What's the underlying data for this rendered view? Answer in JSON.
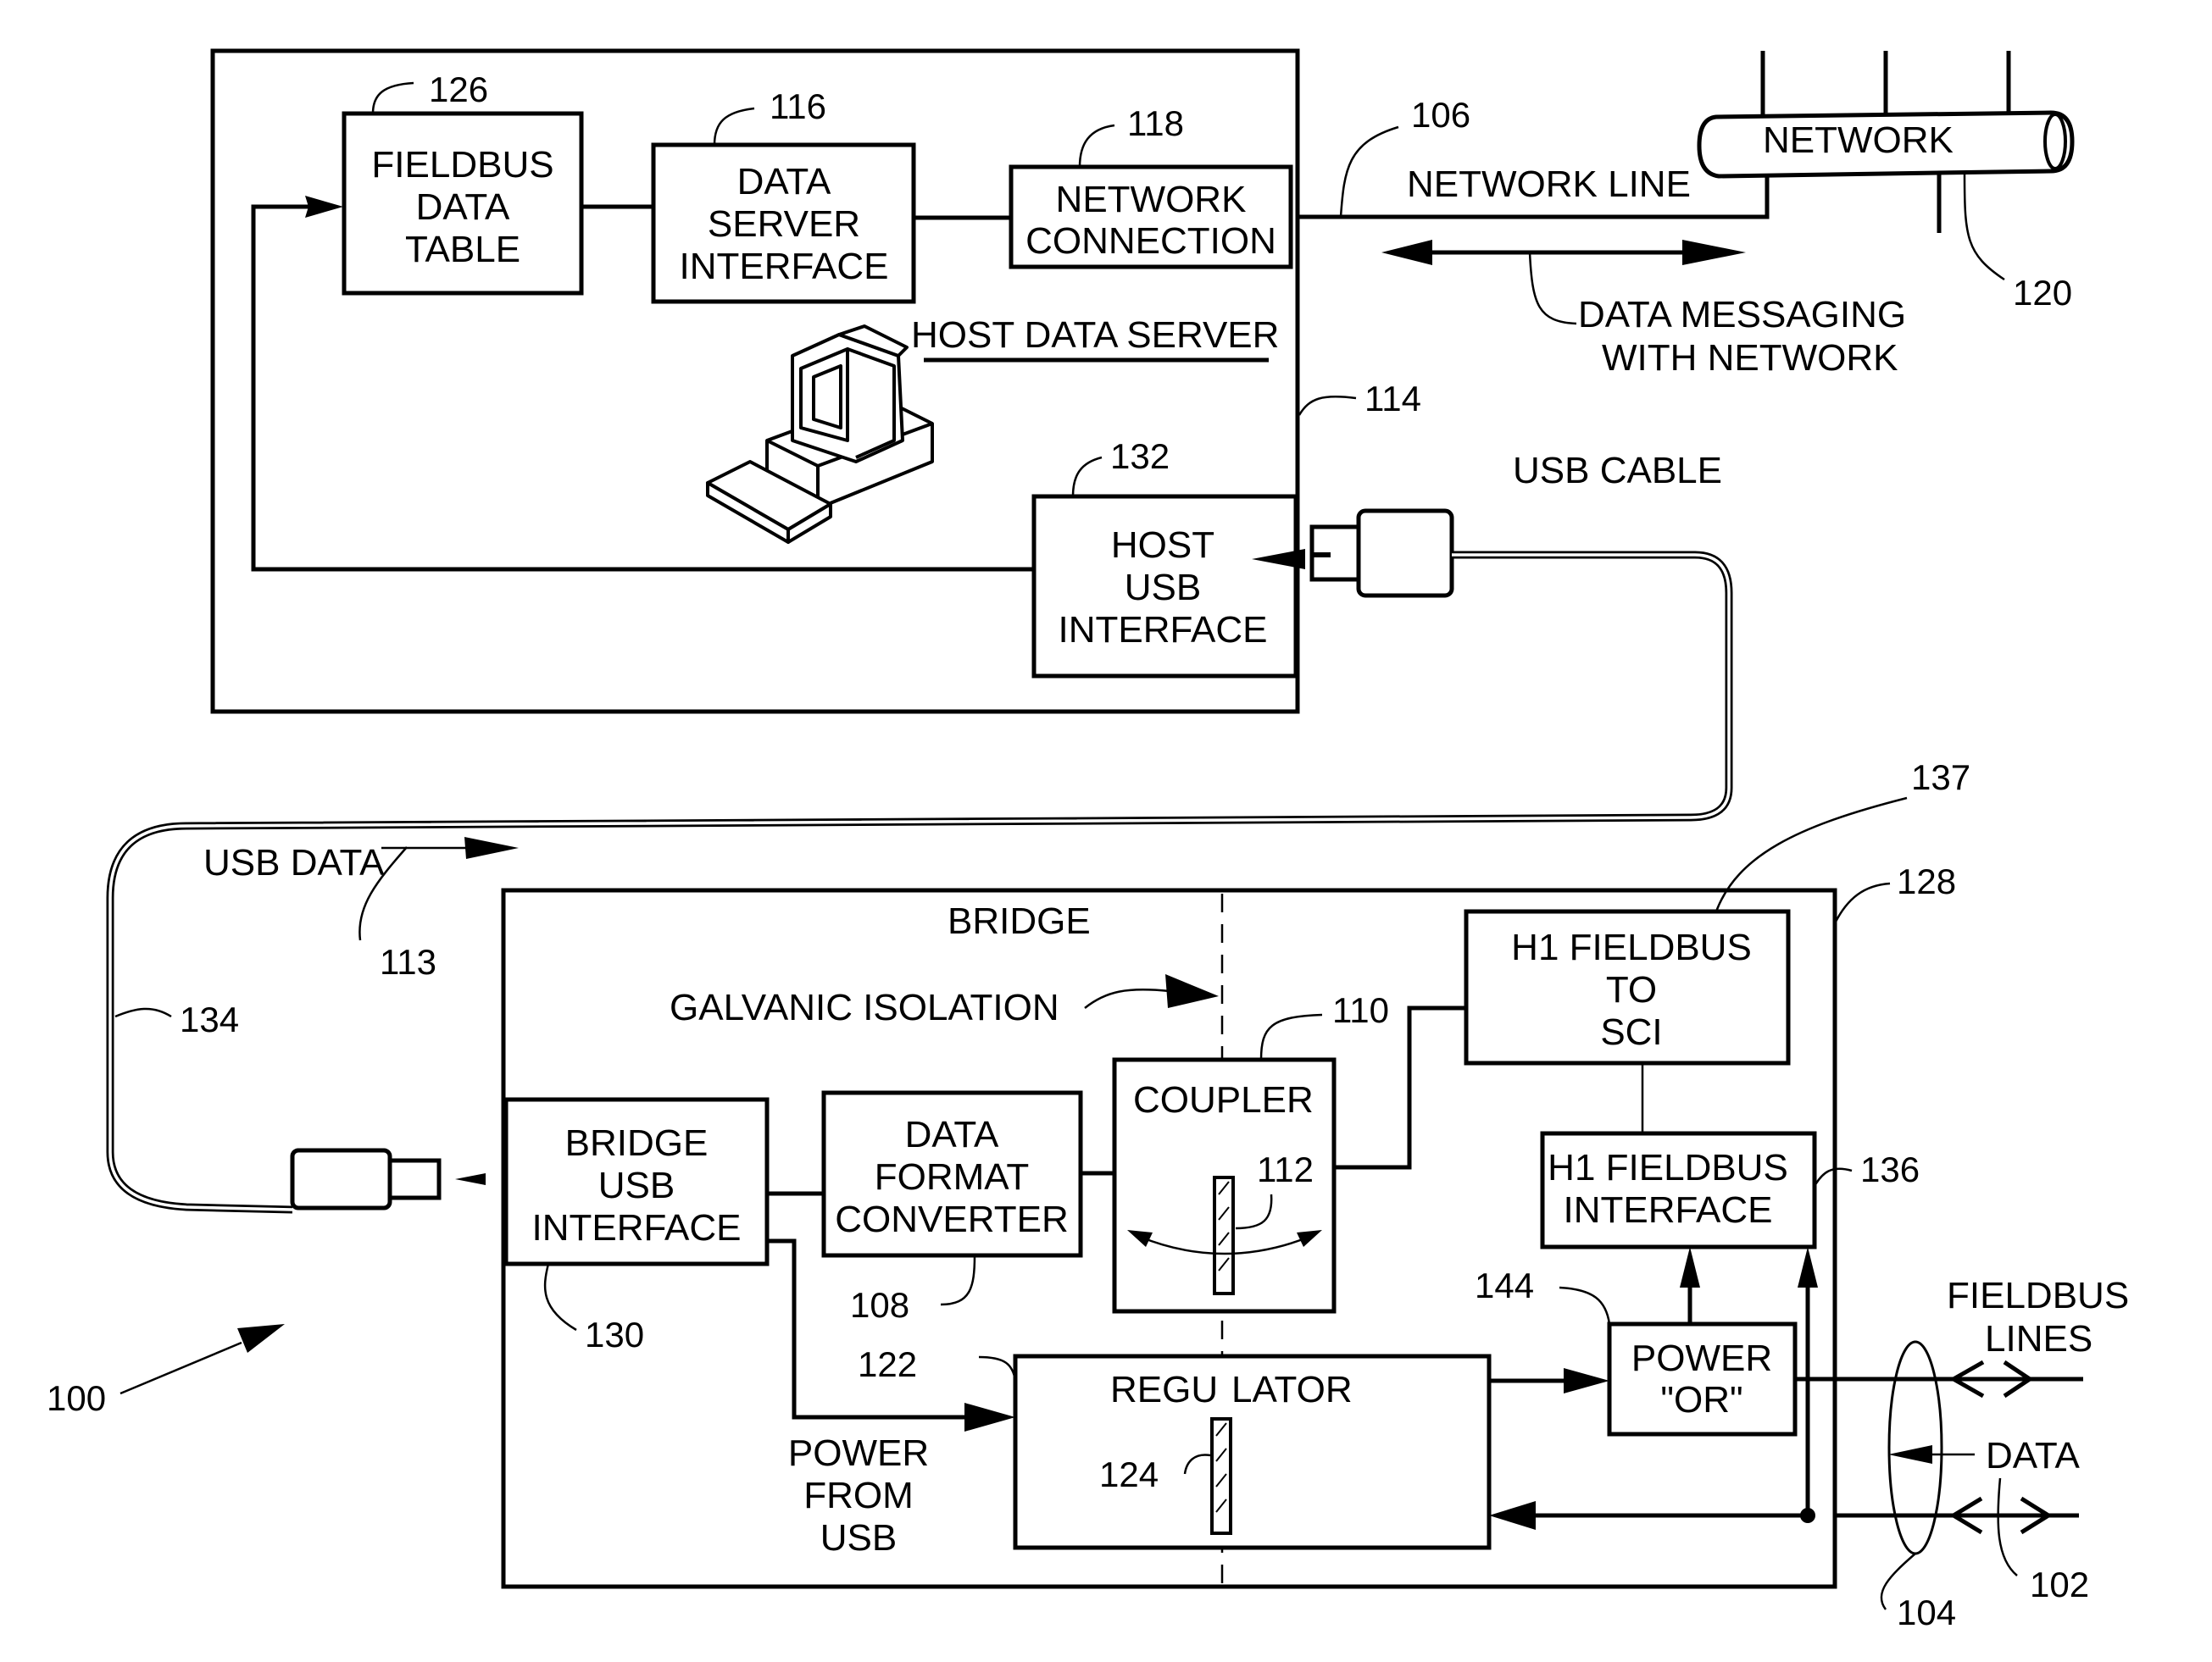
{
  "figure": {
    "system_ref": "100",
    "host": {
      "ref": "114",
      "title": "HOST DATA SERVER",
      "fieldbus_data_table": {
        "ref": "126",
        "lines": [
          "FIELDBUS",
          "DATA",
          "TABLE"
        ]
      },
      "data_server_interface": {
        "ref": "116",
        "lines": [
          "DATA",
          "SERVER",
          "INTERFACE"
        ]
      },
      "network_connection": {
        "ref": "118",
        "lines": [
          "NETWORK",
          "CONNECTION"
        ]
      },
      "host_usb_interface": {
        "ref": "132",
        "lines": [
          "HOST",
          "USB",
          "INTERFACE"
        ]
      }
    },
    "network": {
      "label": "NETWORK",
      "ref": "120",
      "line_label": "NETWORK LINE",
      "line_ref": "106",
      "messaging_lines": [
        "DATA MESSAGING",
        "WITH NETWORK"
      ]
    },
    "usb_cable": {
      "label": "USB CABLE",
      "ref": "134",
      "data_label": "USB DATA",
      "data_ref": "113"
    },
    "bridge": {
      "title": "BRIDGE",
      "ref": "128",
      "galvanic_isolation": "GALVANIC ISOLATION",
      "bridge_usb_interface": {
        "ref": "130",
        "lines": [
          "BRIDGE",
          "USB",
          "INTERFACE"
        ]
      },
      "data_format_converter": {
        "ref": "108",
        "lines": [
          "DATA",
          "FORMAT",
          "CONVERTER"
        ]
      },
      "coupler": {
        "ref": "110",
        "label": "COUPLER",
        "isolator_ref": "112"
      },
      "h1_to_sci": {
        "ref": "137",
        "lines": [
          "H1 FIELDBUS",
          "TO",
          "SCI"
        ]
      },
      "h1_interface": {
        "ref": "136",
        "lines": [
          "H1 FIELDBUS",
          "INTERFACE"
        ]
      },
      "regulator": {
        "ref": "122",
        "label_left": "REGU",
        "label_right": "LATOR",
        "isolator_ref": "124"
      },
      "power_or": {
        "ref": "144",
        "lines": [
          "POWER",
          "\"OR\""
        ]
      },
      "power_from_usb": [
        "POWER",
        "FROM",
        "USB"
      ]
    },
    "fieldbus": {
      "lines_label": [
        "FIELDBUS",
        "LINES"
      ],
      "data_label": "DATA",
      "lines_ref": "102",
      "pair_ref": "104"
    }
  }
}
